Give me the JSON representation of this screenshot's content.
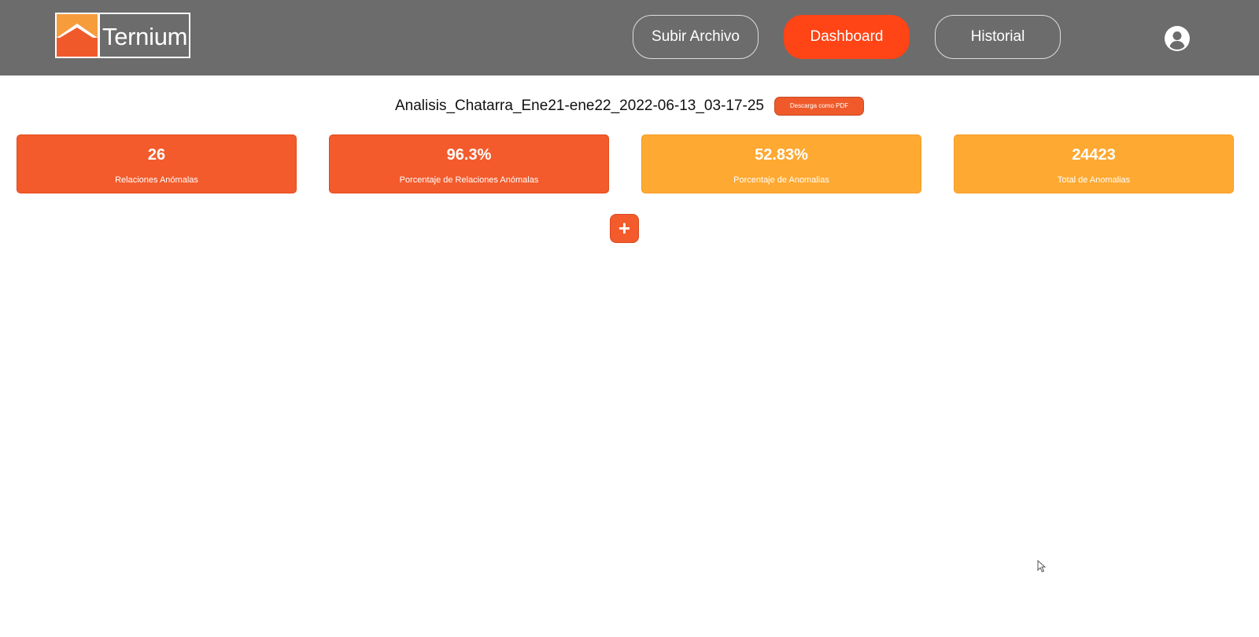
{
  "header": {
    "logo_text": "Ternium",
    "nav": [
      {
        "label": "Subir Archivo"
      },
      {
        "label": "Dashboard"
      },
      {
        "label": "Historial"
      }
    ],
    "account_icon": "user-circle-icon"
  },
  "report": {
    "title": "Analisis_Chatarra_Ene21-ene22_2022-06-13_03-17-25",
    "download_label": "Descarga como PDF"
  },
  "cards": [
    {
      "value": "26",
      "label": "Relaciones Anómalas"
    },
    {
      "value": "96.3%",
      "label": "Porcentaje de Relaciones Anómalas"
    },
    {
      "value": "52.83%",
      "label": "Porcentaje de Anomalias"
    },
    {
      "value": "24423",
      "label": "Total de Anomalias"
    }
  ],
  "add_button": {
    "label": "+"
  },
  "colors": {
    "header_bg": "#6c6c6c",
    "accent": "#ff4416",
    "card_red": "#f35b2c",
    "card_amber": "#fea932"
  }
}
